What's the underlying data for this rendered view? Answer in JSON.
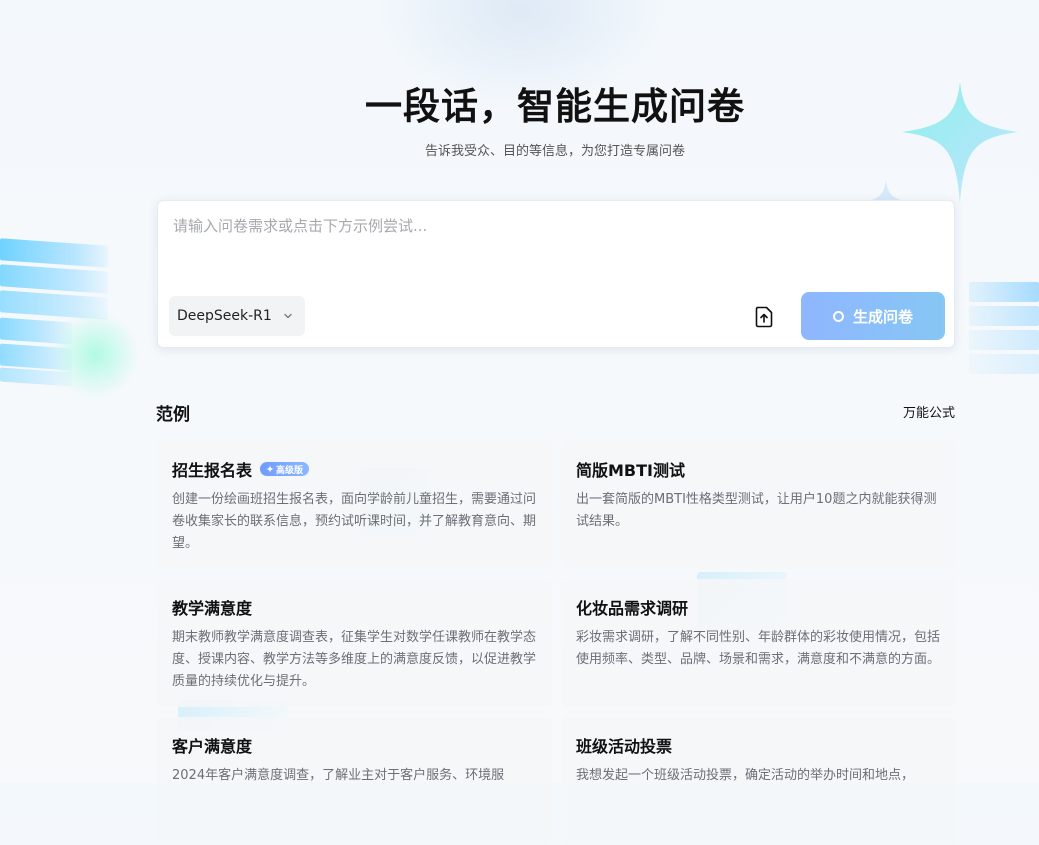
{
  "hero": {
    "title": "一段话，智能生成问卷",
    "subtitle": "告诉我受众、目的等信息，为您打造专属问卷"
  },
  "input": {
    "placeholder": "请输入问卷需求或点击下方示例尝试...",
    "value": "",
    "model": "DeepSeek-R1",
    "generate_label": "生成问卷"
  },
  "examples": {
    "title": "范例",
    "formula_link": "万能公式",
    "items": [
      {
        "title": "招生报名表",
        "badge": "高级版",
        "desc": "创建一份绘画班招生报名表，面向学龄前儿童招生，需要通过问卷收集家长的联系信息，预约试听课时间，并了解教育意向、期望。"
      },
      {
        "title": "简版MBTI测试",
        "desc": "出一套简版的MBTI性格类型测试，让用户10题之内就能获得测试结果。"
      },
      {
        "title": "教学满意度",
        "desc": "期末教师教学满意度调查表，征集学生对数学任课教师在教学态度、授课内容、教学方法等多维度上的满意度反馈，以促进教学质量的持续优化与提升。"
      },
      {
        "title": "化妆品需求调研",
        "desc": "彩妆需求调研，了解不同性别、年龄群体的彩妆使用情况，包括使用频率、类型、品牌、场景和需求，满意度和不满意的方面。"
      },
      {
        "title": "客户满意度",
        "desc": "2024年客户满意度调查，了解业主对于客户服务、环境服"
      },
      {
        "title": "班级活动投票",
        "desc": "我想发起一个班级活动投票，确定活动的举办时间和地点，"
      }
    ]
  },
  "colors": {
    "accent": "#8fb6ff",
    "badge": "#6f9cff"
  },
  "icons": {
    "upload": "upload-file-icon",
    "chevron": "chevron-down-icon",
    "spinner": "loading-spinner-icon",
    "sparkle": "sparkle-icon"
  }
}
